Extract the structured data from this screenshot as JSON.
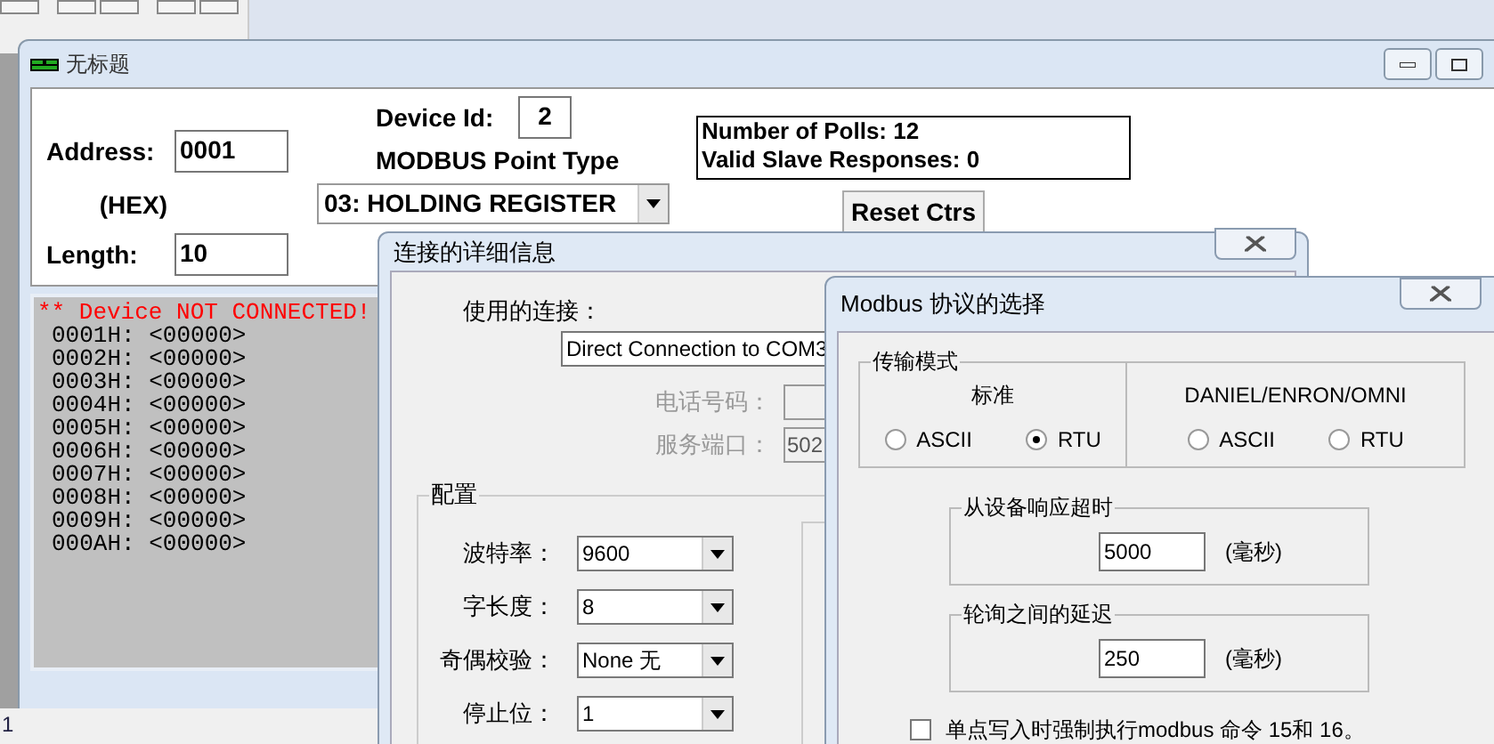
{
  "main_window": {
    "title": "无标题",
    "address_label": "Address:",
    "address_value": "0001",
    "hex_label": "(HEX)",
    "length_label": "Length:",
    "length_value": "10",
    "device_id_label": "Device Id:",
    "device_id_value": "2",
    "point_type_label": "MODBUS Point Type",
    "point_type_value": "03: HOLDING REGISTER",
    "polls": "Number of Polls: 12",
    "responses": "Valid Slave Responses: 0",
    "reset_button": "Reset Ctrs",
    "status_line": "** Device NOT CONNECTED!",
    "registers": [
      "0001H: <00000>",
      "0002H: <00000>",
      "0003H: <00000>",
      "0004H: <00000>",
      "0005H: <00000>",
      "0006H: <00000>",
      "0007H: <00000>",
      "0008H: <00000>",
      "0009H: <00000>",
      "000AH: <00000>"
    ]
  },
  "bottom_fragment": "1",
  "connection_dialog": {
    "title": "连接的详细信息",
    "connection_label": "使用的连接：",
    "connection_value": "Direct Connection to COM3",
    "phone": {
      "label": "电话号码：",
      "disabled": true
    },
    "port": {
      "label": "服务端口：",
      "value": "502",
      "disabled": true
    },
    "config_group": "配置",
    "settings": [
      {
        "label": "波特率：",
        "value": "9600"
      },
      {
        "label": "字长度：",
        "value": "8"
      },
      {
        "label": "奇偶校验：",
        "value": "None 无"
      },
      {
        "label": "停止位：",
        "value": "1"
      }
    ]
  },
  "protocol_dialog": {
    "title": "Modbus 协议的选择",
    "mode_group": "传输模式",
    "standard": {
      "title": "标准",
      "options": [
        {
          "label": "ASCII",
          "selected": false
        },
        {
          "label": "RTU",
          "selected": true
        }
      ]
    },
    "daniel": {
      "title": "DANIEL/ENRON/OMNI",
      "options": [
        {
          "label": "ASCII",
          "selected": false
        },
        {
          "label": "RTU",
          "selected": false
        }
      ]
    },
    "timeout": {
      "title": "从设备响应超时",
      "value": "5000",
      "unit": "(毫秒)"
    },
    "delay": {
      "title": "轮询之间的延迟",
      "value": "250",
      "unit": "(毫秒)"
    },
    "force_multiple": {
      "label": "单点写入时强制执行modbus 命令 15和 16。",
      "checked": false
    }
  }
}
